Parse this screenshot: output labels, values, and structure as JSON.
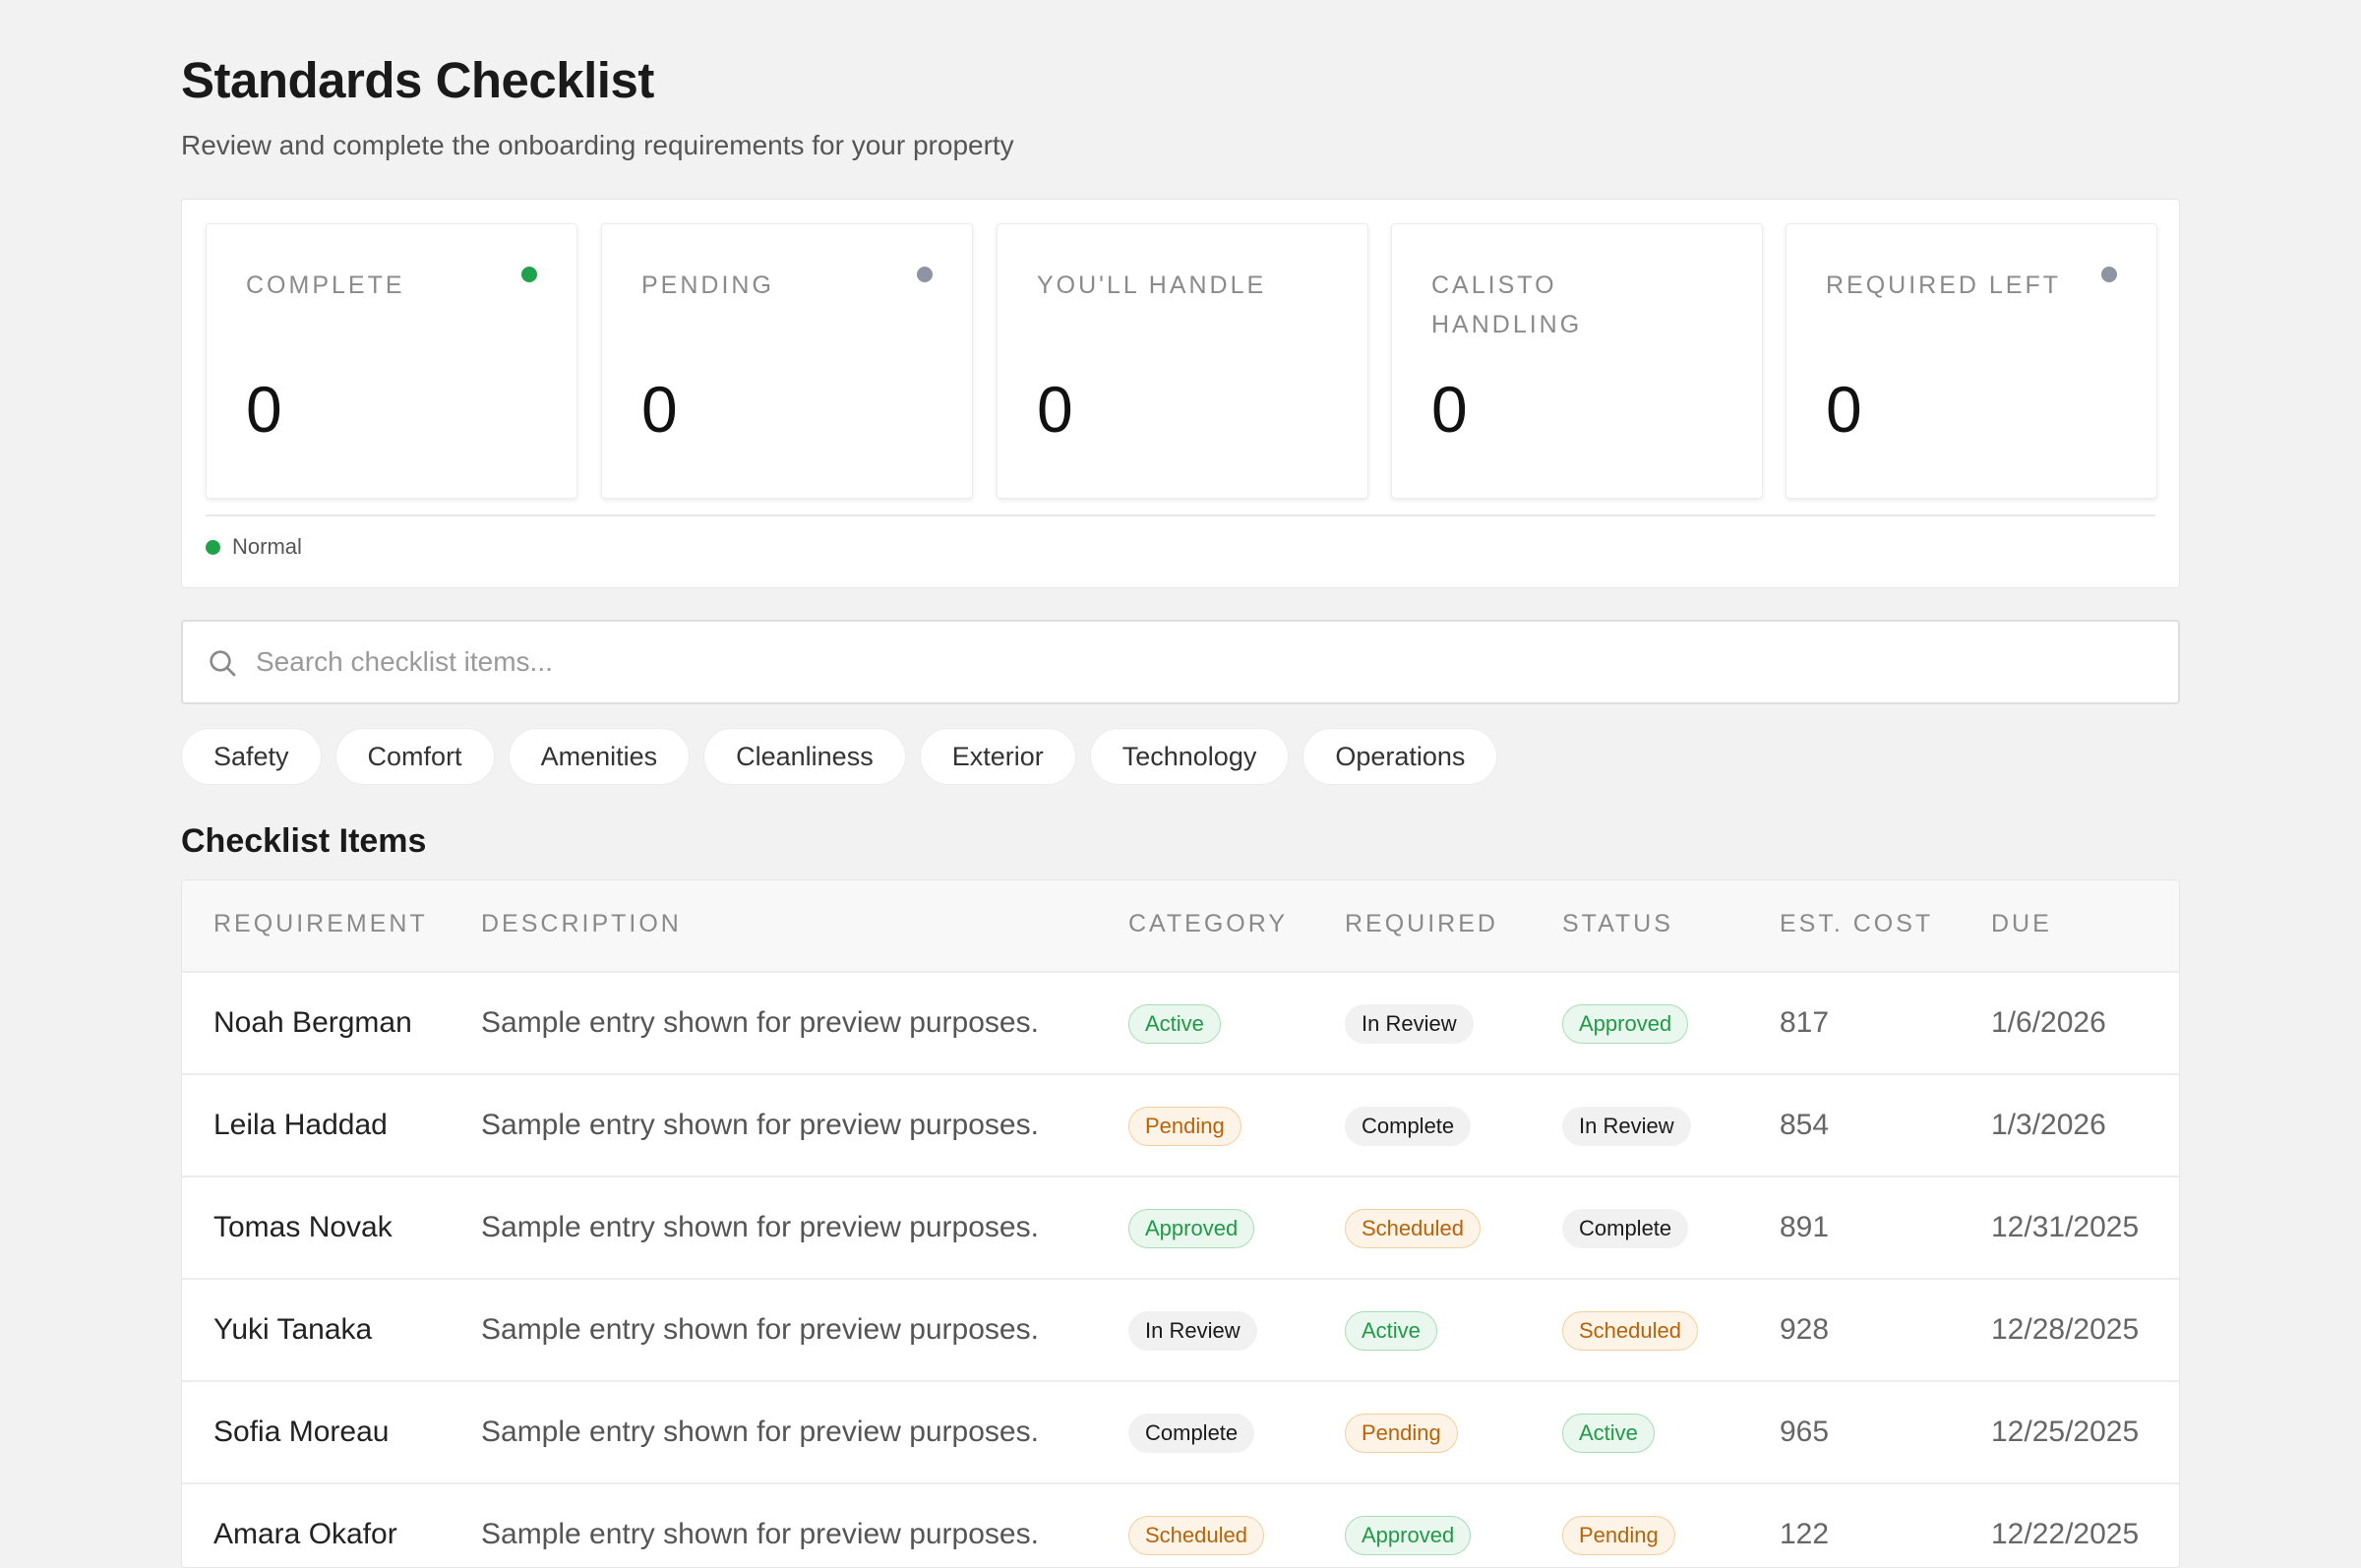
{
  "header": {
    "title": "Standards Checklist",
    "subtitle": "Review and complete the onboarding requirements for your property"
  },
  "stats": [
    {
      "label": "COMPLETE",
      "value": "0",
      "dot": "#1fa34a"
    },
    {
      "label": "PENDING",
      "value": "0",
      "dot": "#8e94a2"
    },
    {
      "label": "YOU'LL HANDLE",
      "value": "0",
      "dot": ""
    },
    {
      "label": "CALISTO HANDLING",
      "value": "0",
      "dot": ""
    },
    {
      "label": "REQUIRED LEFT",
      "value": "0",
      "dot": "#8e94a2"
    }
  ],
  "legend": {
    "label": "Normal",
    "color": "#1fa34a"
  },
  "search": {
    "placeholder": "Search checklist items..."
  },
  "filters": [
    "Safety",
    "Comfort",
    "Amenities",
    "Cleanliness",
    "Exterior",
    "Technology",
    "Operations"
  ],
  "table": {
    "title": "Checklist Items",
    "columns": {
      "requirement": "REQUIREMENT",
      "description": "DESCRIPTION",
      "category": "CATEGORY",
      "required": "REQUIRED",
      "status": "STATUS",
      "cost": "EST. COST",
      "due": "DUE"
    },
    "rows": [
      {
        "requirement": "Noah Bergman",
        "description": "Sample entry shown for preview purposes.",
        "category": "Active",
        "required": "In Review",
        "status": "Approved",
        "cost": "817",
        "due": "1/6/2026"
      },
      {
        "requirement": "Leila Haddad",
        "description": "Sample entry shown for preview purposes.",
        "category": "Pending",
        "required": "Complete",
        "status": "In Review",
        "cost": "854",
        "due": "1/3/2026"
      },
      {
        "requirement": "Tomas Novak",
        "description": "Sample entry shown for preview purposes.",
        "category": "Approved",
        "required": "Scheduled",
        "status": "Complete",
        "cost": "891",
        "due": "12/31/2025"
      },
      {
        "requirement": "Yuki Tanaka",
        "description": "Sample entry shown for preview purposes.",
        "category": "In Review",
        "required": "Active",
        "status": "Scheduled",
        "cost": "928",
        "due": "12/28/2025"
      },
      {
        "requirement": "Sofia Moreau",
        "description": "Sample entry shown for preview purposes.",
        "category": "Complete",
        "required": "Pending",
        "status": "Active",
        "cost": "965",
        "due": "12/25/2025"
      },
      {
        "requirement": "Amara Okafor",
        "description": "Sample entry shown for preview purposes.",
        "category": "Scheduled",
        "required": "Approved",
        "status": "Pending",
        "cost": "122",
        "due": "12/22/2025"
      }
    ]
  },
  "badge_colors": {
    "success": "#1f9a46",
    "warning": "#b8630a",
    "neutral": "#1a1a1a"
  }
}
